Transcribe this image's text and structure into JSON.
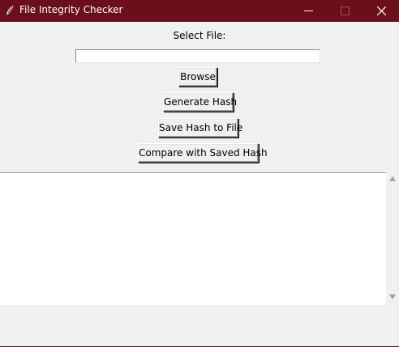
{
  "window": {
    "title": "File Integrity Checker",
    "icon": "feather-icon",
    "accent_color": "#6b0f1a",
    "controls": [
      "minimize-icon",
      "maximize-icon",
      "close-icon"
    ]
  },
  "main": {
    "select_label": "Select File:",
    "file_path_value": "",
    "buttons": {
      "browse": "Browse",
      "generate": "Generate Hash",
      "save": "Save Hash to File",
      "compare": "Compare with Saved Hash"
    },
    "output_text": ""
  },
  "scrollbar": {
    "up_icon": "arrow-up-icon",
    "down_icon": "arrow-down-icon"
  }
}
